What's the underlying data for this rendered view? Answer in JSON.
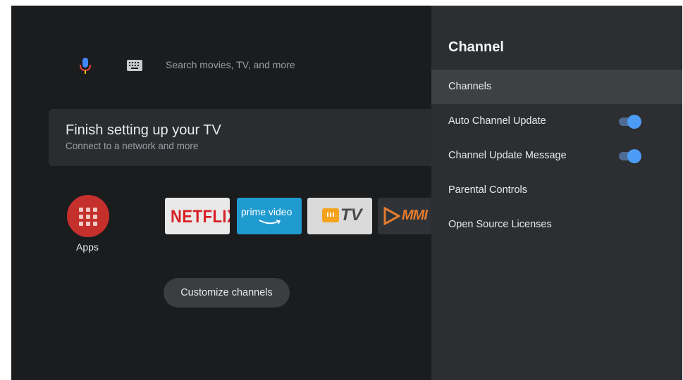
{
  "search": {
    "placeholder": "Search movies, TV, and more",
    "mic_icon": "microphone-icon",
    "keyboard_icon": "keyboard-icon"
  },
  "setup_card": {
    "title": "Finish setting up your TV",
    "subtitle": "Connect to a network and more"
  },
  "apps": {
    "label": "Apps",
    "icon": "apps-grid-icon",
    "color": "#c5302c"
  },
  "tiles": [
    {
      "name": "Netflix",
      "text": "NETFLIX",
      "color": "#d81f26"
    },
    {
      "name": "Prime Video",
      "text": "prime video",
      "color": "#1f9bd0"
    },
    {
      "name": "MX TV",
      "text": "TV",
      "color": "#f4a31d"
    },
    {
      "name": "MM",
      "text": "MMI",
      "color": "#e37b2f"
    }
  ],
  "customize": {
    "label": "Customize channels"
  },
  "panel": {
    "title": "Channel",
    "items": [
      {
        "label": "Channels",
        "focused": true
      },
      {
        "label": "Auto Channel Update",
        "toggle": true,
        "on": true
      },
      {
        "label": "Channel Update Message",
        "toggle": true,
        "on": true
      },
      {
        "label": "Parental Controls"
      },
      {
        "label": "Open Source Licenses"
      }
    ],
    "accent": "#4c9bf5"
  }
}
